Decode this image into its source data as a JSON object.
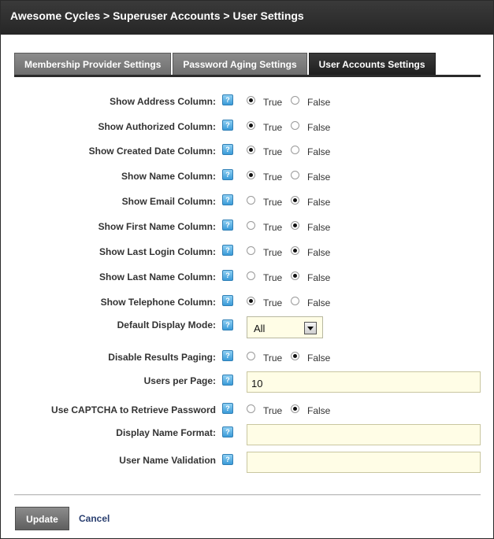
{
  "header": {
    "title": "Awesome Cycles > Superuser Accounts > User Settings"
  },
  "tabs": [
    {
      "label": "Membership Provider Settings",
      "active": false
    },
    {
      "label": "Password Aging Settings",
      "active": false
    },
    {
      "label": "User Accounts Settings",
      "active": true
    }
  ],
  "radio_labels": {
    "true": "True",
    "false": "False"
  },
  "help_icon_glyph": "?",
  "fields": {
    "show_address": {
      "label": "Show Address Column:",
      "value": "True"
    },
    "show_authorized": {
      "label": "Show Authorized Column:",
      "value": "True"
    },
    "show_created_date": {
      "label": "Show Created Date Column:",
      "value": "True"
    },
    "show_name": {
      "label": "Show Name Column:",
      "value": "True"
    },
    "show_email": {
      "label": "Show Email Column:",
      "value": "False"
    },
    "show_first_name": {
      "label": "Show First Name Column:",
      "value": "False"
    },
    "show_last_login": {
      "label": "Show Last Login Column:",
      "value": "False"
    },
    "show_last_name": {
      "label": "Show Last Name Column:",
      "value": "False"
    },
    "show_telephone": {
      "label": "Show Telephone Column:",
      "value": "True"
    },
    "default_display_mode": {
      "label": "Default Display Mode:",
      "value": "All"
    },
    "disable_results_paging": {
      "label": "Disable Results Paging:",
      "value": "False"
    },
    "users_per_page": {
      "label": "Users per Page:",
      "value": "10"
    },
    "use_captcha": {
      "label": "Use CAPTCHA to Retrieve Password",
      "value": "False"
    },
    "display_name_format": {
      "label": "Display Name Format:",
      "value": ""
    },
    "user_name_validation": {
      "label": "User Name Validation",
      "value": ""
    }
  },
  "actions": {
    "update": "Update",
    "cancel": "Cancel"
  },
  "colors": {
    "header_bg": "#262626",
    "active_tab": "#1e1e1e",
    "inactive_tab": "#7a7a7a",
    "input_bg": "#fffde6",
    "help_icon": "#3a9bd8",
    "cancel_link": "#2a3f70"
  }
}
